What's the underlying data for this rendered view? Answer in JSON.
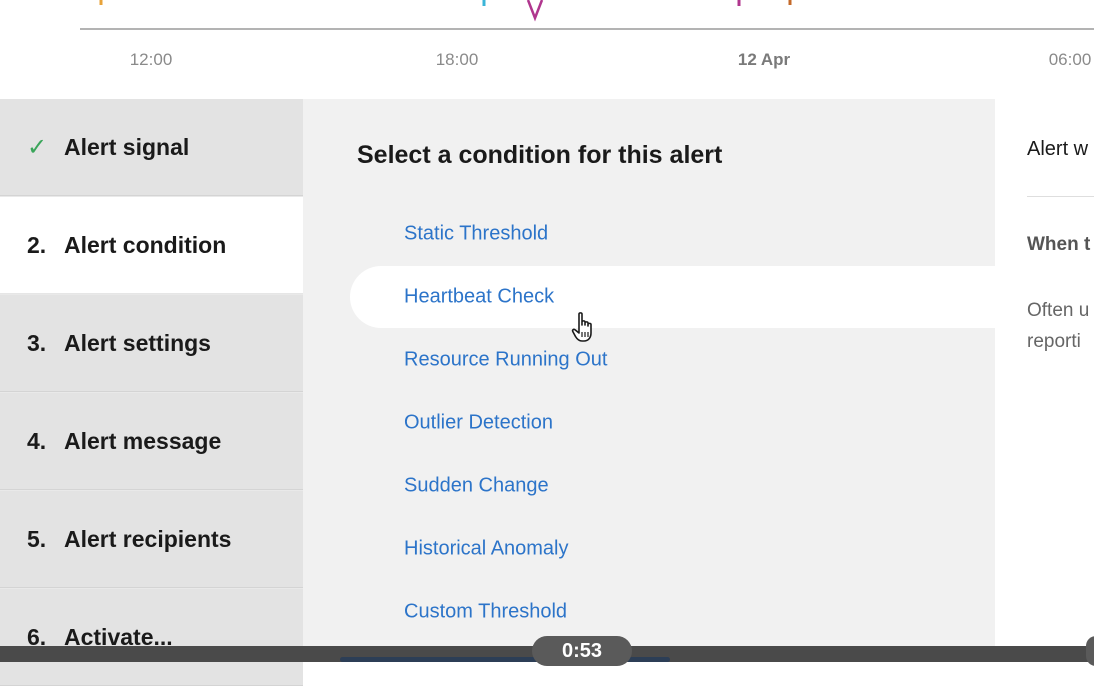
{
  "chart": {
    "x_ticks": [
      "12:00",
      "18:00",
      "12 Apr",
      "06:00"
    ],
    "marker_colors": [
      "#e8a33a",
      "#3bb5d8",
      "#b0368e",
      "#b0368e",
      "#c46a2a"
    ]
  },
  "sidebar": {
    "steps": [
      {
        "number": "",
        "label": "Alert signal",
        "status": "complete"
      },
      {
        "number": "2.",
        "label": "Alert condition",
        "status": "active"
      },
      {
        "number": "3.",
        "label": "Alert settings",
        "status": "pending"
      },
      {
        "number": "4.",
        "label": "Alert message",
        "status": "pending"
      },
      {
        "number": "5.",
        "label": "Alert recipients",
        "status": "pending"
      },
      {
        "number": "6.",
        "label": "Activate...",
        "status": "pending"
      }
    ],
    "check_icon": "checkmark-icon",
    "check_color": "#3aa55a"
  },
  "main": {
    "title": "Select a condition for this alert",
    "conditions": [
      "Static Threshold",
      "Heartbeat Check",
      "Resource Running Out",
      "Outlier Detection",
      "Sudden Change",
      "Historical Anomaly",
      "Custom Threshold"
    ],
    "hovered": "Heartbeat Check",
    "link_color": "#2c74c9"
  },
  "detail": {
    "heading": "Alert w",
    "when": "When t",
    "desc_line1": "Often u",
    "desc_line2": "reporti"
  },
  "video": {
    "time": "0:53"
  }
}
